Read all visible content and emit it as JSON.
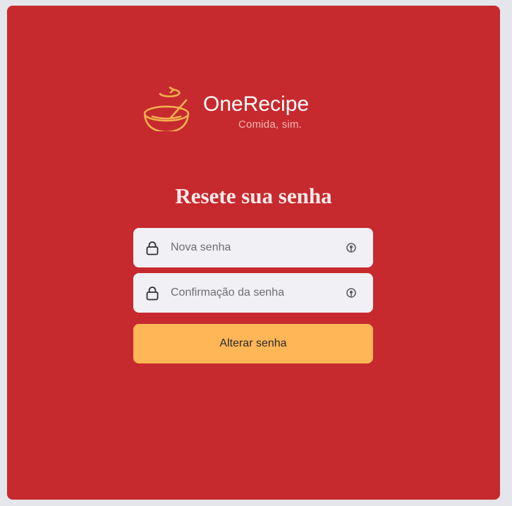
{
  "brand": {
    "name": "OneRecipe",
    "tagline": "Comida, sim."
  },
  "form": {
    "title": "Resete sua senha",
    "new_password": {
      "placeholder": "Nova senha",
      "value": ""
    },
    "confirm_password": {
      "placeholder": "Confirmação da senha",
      "value": ""
    },
    "submit_label": "Alterar senha"
  },
  "icons": {
    "logo": "bowl-logo-icon",
    "field_prefix": "lock-icon",
    "field_suffix": "password-visibility-icon"
  },
  "colors": {
    "background": "#c62a2e",
    "accent": "#ffb657",
    "field_background": "#f1f0f5"
  }
}
